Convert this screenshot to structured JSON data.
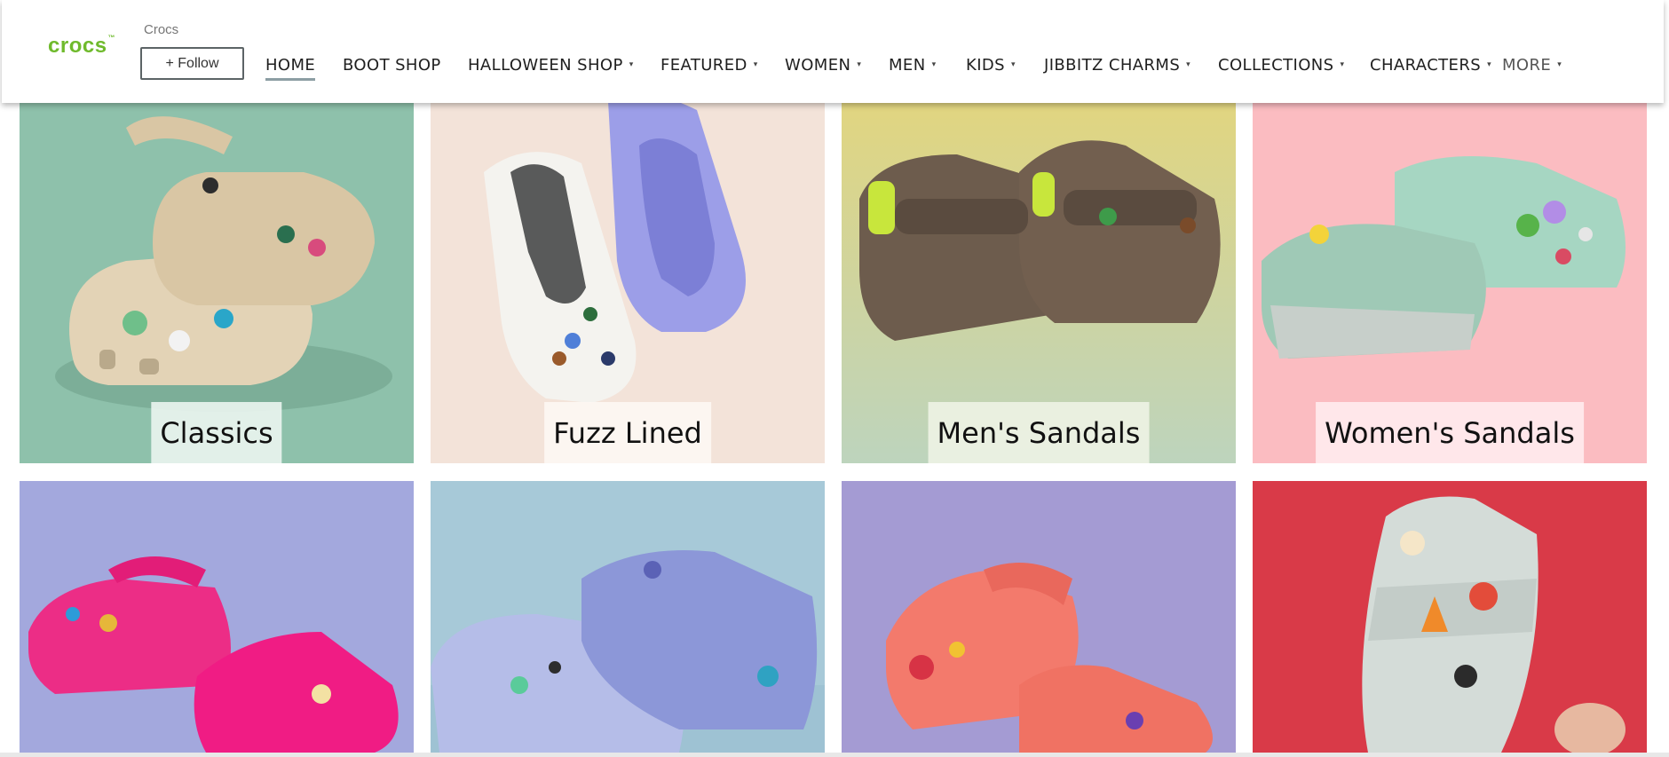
{
  "header": {
    "logo_text": "crocs",
    "logo_mark": "™",
    "brand_name": "Crocs",
    "follow_label": "+ Follow",
    "brand_color": "#6fba2c"
  },
  "nav": {
    "items": [
      {
        "label": "HOME",
        "active": true,
        "dropdown": false
      },
      {
        "label": "BOOT SHOP",
        "dropdown": false
      },
      {
        "label": "HALLOWEEN SHOP",
        "dropdown": true
      },
      {
        "label": "FEATURED",
        "dropdown": true
      },
      {
        "label": "WOMEN",
        "dropdown": true
      },
      {
        "label": "MEN",
        "dropdown": true
      },
      {
        "label": "KIDS",
        "dropdown": true
      },
      {
        "label": "JIBBITZ CHARMS",
        "dropdown": true
      },
      {
        "label": "COLLECTIONS",
        "dropdown": true
      },
      {
        "label": "CHARACTERS",
        "dropdown": true
      },
      {
        "label": "MORE",
        "dropdown": true
      }
    ],
    "caret_glyph": "▾"
  },
  "tiles": [
    {
      "caption": "Classics",
      "bg": "#8ec1ab",
      "product": "beige classic clog"
    },
    {
      "caption": "Fuzz Lined",
      "bg": "#f3e3d9",
      "product": "white and lavender lined clogs"
    },
    {
      "caption": "Men's Sandals",
      "bg": "#d3d58a",
      "product": "brown sandals"
    },
    {
      "caption": "Women's Sandals",
      "bg": "#fbbcc1",
      "product": "mint platform slides"
    },
    {
      "caption": "",
      "bg": "#a3a8dd",
      "product": "pink platform clogs"
    },
    {
      "caption": "",
      "bg": "#a7c9d8",
      "product": "glitter blue clogs"
    },
    {
      "caption": "",
      "bg": "#a49bd3",
      "product": "coral clogs"
    },
    {
      "caption": "",
      "bg": "#d93a48",
      "product": "grey sandal"
    }
  ]
}
